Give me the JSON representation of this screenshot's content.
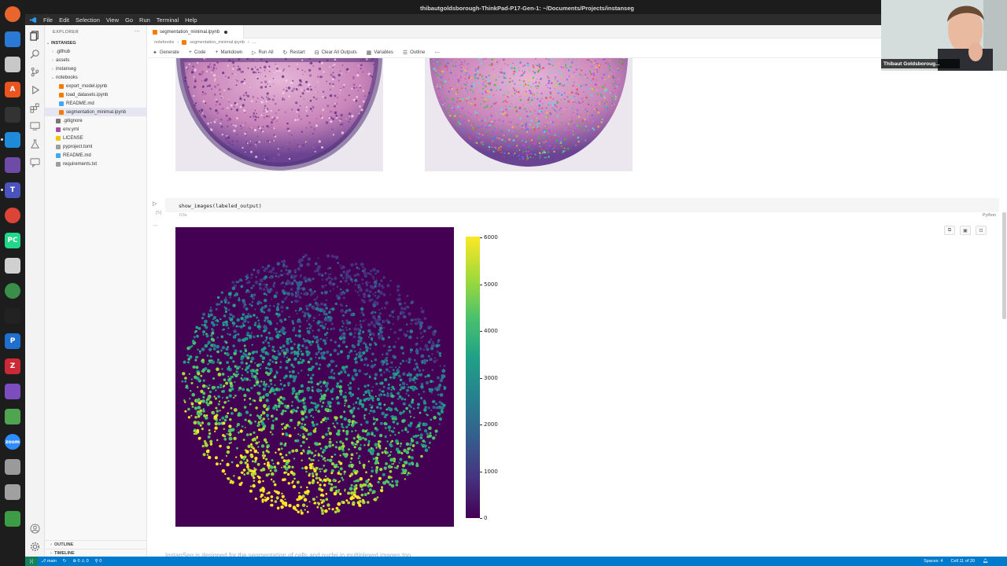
{
  "window": {
    "title": "thibautgoldsborough-ThinkPad-P17-Gen-1: ~/Documents/Projects/instanseg"
  },
  "menu": [
    "File",
    "Edit",
    "Selection",
    "View",
    "Go",
    "Run",
    "Terminal",
    "Help"
  ],
  "dock": {
    "apps": [
      {
        "name": "firefox-icon",
        "color": "#e8652d",
        "label": ""
      },
      {
        "name": "docs-icon",
        "color": "#2a7ad5",
        "label": ""
      },
      {
        "name": "files-icon",
        "color": "#c8c8c8",
        "label": ""
      },
      {
        "name": "app-store-icon",
        "color": "#e95420",
        "label": "A"
      },
      {
        "name": "terminal-icon",
        "color": "#333333",
        "label": ""
      },
      {
        "name": "vscode-icon",
        "color": "#1f8ad8",
        "label": ""
      },
      {
        "name": "github-icon",
        "color": "#6e4ba6",
        "label": ""
      },
      {
        "name": "teams-icon",
        "color": "#4b53bc",
        "label": "T"
      },
      {
        "name": "chrome-icon",
        "color": "#db4437",
        "label": ""
      },
      {
        "name": "pycharm-icon",
        "color": "#21d789",
        "label": "PC"
      },
      {
        "name": "magnifier-icon",
        "color": "#d0d0d0",
        "label": ""
      },
      {
        "name": "globe-icon",
        "color": "#3a8e4a",
        "label": ""
      },
      {
        "name": "inkscape-icon",
        "color": "#222222",
        "label": ""
      },
      {
        "name": "publisher-icon",
        "color": "#1f6fd1",
        "label": "P"
      },
      {
        "name": "zotero-icon",
        "color": "#cc2936",
        "label": "Z"
      },
      {
        "name": "obsidian-icon",
        "color": "#7c4dbf",
        "label": ""
      },
      {
        "name": "image-editor-icon",
        "color": "#4fa54f",
        "label": ""
      },
      {
        "name": "zoom-icon",
        "color": "#2d8cff",
        "label": "zoom"
      },
      {
        "name": "drive-icon",
        "color": "#9a9a9a",
        "label": ""
      },
      {
        "name": "ssd-icon",
        "color": "#a0a0a0",
        "label": ""
      },
      {
        "name": "recycle-icon",
        "color": "#3d9c46",
        "label": ""
      }
    ]
  },
  "explorer": {
    "header": "EXPLORER",
    "root": "INSTANSEG",
    "items": [
      {
        "label": ".github",
        "depth": 1,
        "type": "folder",
        "arrow": "›",
        "color": "#888888"
      },
      {
        "label": "assets",
        "depth": 1,
        "type": "folder",
        "arrow": "›",
        "color": "#888888"
      },
      {
        "label": "instanseg",
        "depth": 1,
        "type": "folder",
        "arrow": "›",
        "color": "#888888"
      },
      {
        "label": "notebooks",
        "depth": 1,
        "type": "folder",
        "arrow": "⌄",
        "color": "#888888"
      },
      {
        "label": "export_model.ipynb",
        "depth": 2,
        "type": "file",
        "arrow": "",
        "color": "#f57c00"
      },
      {
        "label": "load_datasets.ipynb",
        "depth": 2,
        "type": "file",
        "arrow": "",
        "color": "#f57c00"
      },
      {
        "label": "README.md",
        "depth": 2,
        "type": "file",
        "arrow": "",
        "color": "#42a5f5"
      },
      {
        "label": "segmentation_minimal.ipynb",
        "depth": 2,
        "type": "file",
        "arrow": "",
        "color": "#f57c00",
        "selected": true
      },
      {
        "label": ".gitignore",
        "depth": 1,
        "type": "file",
        "arrow": "",
        "color": "#777777"
      },
      {
        "label": "env.yml",
        "depth": 1,
        "type": "file",
        "arrow": "",
        "color": "#a64ca6"
      },
      {
        "label": "LICENSE",
        "depth": 1,
        "type": "file",
        "arrow": "",
        "color": "#f4c20d"
      },
      {
        "label": "pyproject.toml",
        "depth": 1,
        "type": "file",
        "arrow": "",
        "color": "#9e9e9e"
      },
      {
        "label": "README.md",
        "depth": 1,
        "type": "file",
        "arrow": "",
        "color": "#42a5f5"
      },
      {
        "label": "requirements.txt",
        "depth": 1,
        "type": "file",
        "arrow": "",
        "color": "#9e9e9e"
      }
    ],
    "footer": [
      "OUTLINE",
      "TIMELINE"
    ]
  },
  "editor": {
    "tab_label": "segmentation_minimal.ipynb",
    "breadcrumb": [
      "notebooks",
      "›",
      "segmentation_minimal.ipynb",
      "›",
      "..."
    ],
    "toolbar": [
      {
        "icon": "sparkle-icon",
        "glyph": "✦",
        "label": "Generate"
      },
      {
        "icon": "plus-icon",
        "glyph": "+",
        "label": "Code"
      },
      {
        "icon": "plus-icon",
        "glyph": "+",
        "label": "Markdown"
      },
      {
        "icon": "play-icon",
        "glyph": "▷",
        "label": "Run All"
      },
      {
        "icon": "restart-icon",
        "glyph": "↻",
        "label": "Restart"
      },
      {
        "icon": "clear-icon",
        "glyph": "⊟",
        "label": "Clear All Outputs"
      },
      {
        "icon": "variables-icon",
        "glyph": "▦",
        "label": "Variables"
      },
      {
        "icon": "outline-icon",
        "glyph": "☰",
        "label": "Outline"
      },
      {
        "icon": "more-icon",
        "glyph": "⋯",
        "label": ""
      }
    ]
  },
  "cell": {
    "code": "show_images(labeled_output)",
    "exec_count": "[5]",
    "exec_time": "0.5s",
    "language": "Python"
  },
  "colorbar": {
    "ticks": [
      "6000",
      "5000",
      "4000",
      "3000",
      "2000",
      "1000",
      "0"
    ],
    "colormap": "viridis"
  },
  "status": {
    "branch": "main",
    "problems": "⊗ 0 ⚠ 0",
    "ports": "⚲ 0",
    "spaces": "Spaces: 4",
    "cell": "Cell 11 of 20"
  },
  "bottom_text": "InstanSeg is designed for the segmentation of cells and nuclei in multiplexed images too.",
  "webcam_name": "Thibaut Goldsboroug..."
}
